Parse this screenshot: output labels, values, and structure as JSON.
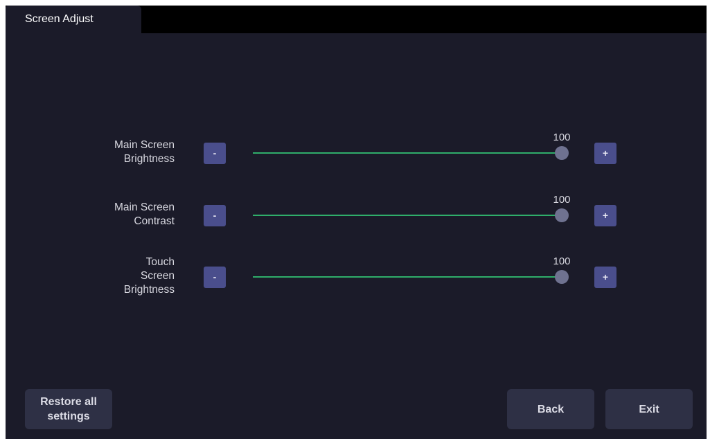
{
  "tab": {
    "label": "Screen Adjust"
  },
  "settings": [
    {
      "label": "Main Screen\nBrightness",
      "value": 100,
      "value_text": "100",
      "min": 0,
      "max": 100,
      "decrement_label": "-",
      "increment_label": "+"
    },
    {
      "label": "Main Screen\nContrast",
      "value": 100,
      "value_text": "100",
      "min": 0,
      "max": 100,
      "decrement_label": "-",
      "increment_label": "+"
    },
    {
      "label": "Touch\nScreen\nBrightness",
      "value": 100,
      "value_text": "100",
      "min": 0,
      "max": 100,
      "decrement_label": "-",
      "increment_label": "+"
    }
  ],
  "actions": {
    "restore_label": "Restore all\nsettings",
    "back_label": "Back",
    "exit_label": "Exit"
  },
  "colors": {
    "background": "#1b1b29",
    "tab_strip": "#000000",
    "step_button": "#4a4e8c",
    "track": "#2fae6a",
    "thumb": "#6f7290",
    "action_button": "#2e3045"
  }
}
